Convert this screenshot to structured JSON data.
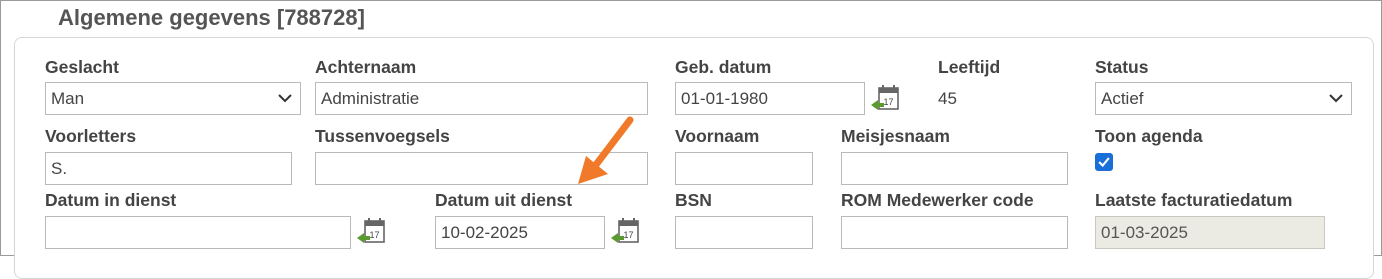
{
  "section": {
    "title": "Algemene gegevens [788728]"
  },
  "fields": {
    "geslacht": {
      "label": "Geslacht",
      "value": "Man"
    },
    "achternaam": {
      "label": "Achternaam",
      "value": "Administratie"
    },
    "geb_datum": {
      "label": "Geb. datum",
      "value": "01-01-1980"
    },
    "leeftijd": {
      "label": "Leeftijd",
      "value": "45"
    },
    "status": {
      "label": "Status",
      "value": "Actief"
    },
    "voorletters": {
      "label": "Voorletters",
      "value": "S."
    },
    "tussenvoegsels": {
      "label": "Tussenvoegsels",
      "value": ""
    },
    "voornaam": {
      "label": "Voornaam",
      "value": ""
    },
    "meisjesnaam": {
      "label": "Meisjesnaam",
      "value": ""
    },
    "toon_agenda": {
      "label": "Toon agenda",
      "checked": true
    },
    "datum_in_dienst": {
      "label": "Datum in dienst",
      "value": ""
    },
    "datum_uit_dienst": {
      "label": "Datum uit dienst",
      "value": "10-02-2025"
    },
    "bsn": {
      "label": "BSN",
      "value": ""
    },
    "rom_code": {
      "label": "ROM Medewerker code",
      "value": ""
    },
    "laatste_facturatiedatum": {
      "label": "Laatste facturatiedatum",
      "value": "01-03-2025"
    }
  },
  "calendar_icon": {
    "day": "17"
  },
  "colors": {
    "annotation_arrow": "#f07a2a",
    "checkbox": "#1a6ed8",
    "calendar_green": "#5a9a2e"
  },
  "icons": [
    "calendar-icon",
    "chevron-down-icon",
    "checkmark-icon",
    "annotation-arrow"
  ]
}
